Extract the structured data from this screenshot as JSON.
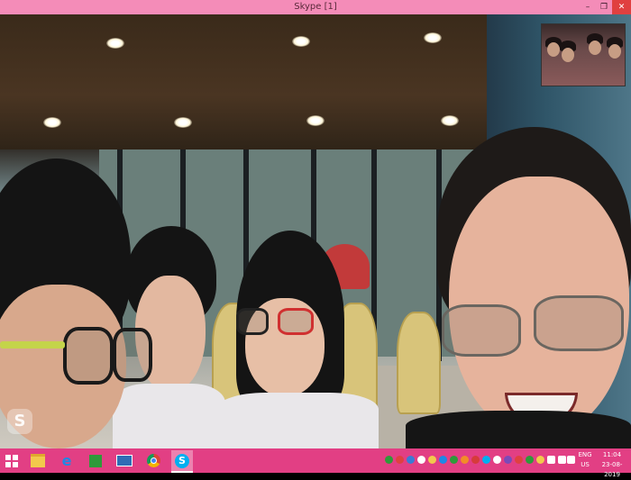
{
  "window": {
    "title": "Skype [1]",
    "minimize_glyph": "–",
    "maximize_glyph": "❐",
    "close_glyph": "✕",
    "titlebar_color": "#f48cb8",
    "close_color": "#e04040"
  },
  "call": {
    "watermark_glyph": "S"
  },
  "taskbar": {
    "color": "#e23f84",
    "pinned_icons": [
      "windows-start-icon",
      "file-explorer-icon",
      "internet-explorer-icon",
      "store-icon",
      "computer-icon",
      "chrome-icon",
      "skype-icon"
    ],
    "language_line1": "ENG",
    "language_line2": "US",
    "time": "11:04",
    "date": "23-08-2019"
  }
}
